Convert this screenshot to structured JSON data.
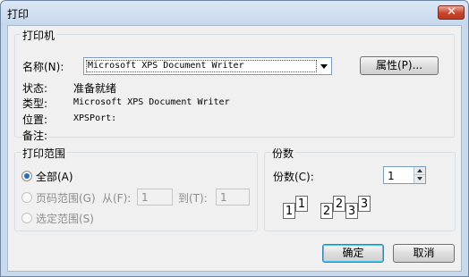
{
  "window": {
    "title": "打印",
    "close_glyph": "✕"
  },
  "printer": {
    "group_title": "打印机",
    "name_label": "名称(N):",
    "selected": "Microsoft XPS Document Writer",
    "properties_button": "属性(P)...",
    "status_label": "状态:",
    "status_value": "准备就绪",
    "type_label": "类型:",
    "type_value": "Microsoft XPS Document Writer",
    "location_label": "位置:",
    "location_value": "XPSPort:",
    "comment_label": "备注:",
    "comment_value": ""
  },
  "range": {
    "group_title": "打印范围",
    "all_label": "全部(A)",
    "pages_label": "页码范围(G)",
    "from_label": "从(F):",
    "from_value": "1",
    "to_label": "到(T):",
    "to_value": "1",
    "selection_label": "选定范围(S)",
    "selected_option": "all"
  },
  "copies": {
    "group_title": "份数",
    "label": "份数(C):",
    "value": "1",
    "collate_pages": [
      "1",
      "1",
      "2",
      "2",
      "3",
      "3"
    ]
  },
  "buttons": {
    "ok": "确定",
    "cancel": "取消"
  }
}
